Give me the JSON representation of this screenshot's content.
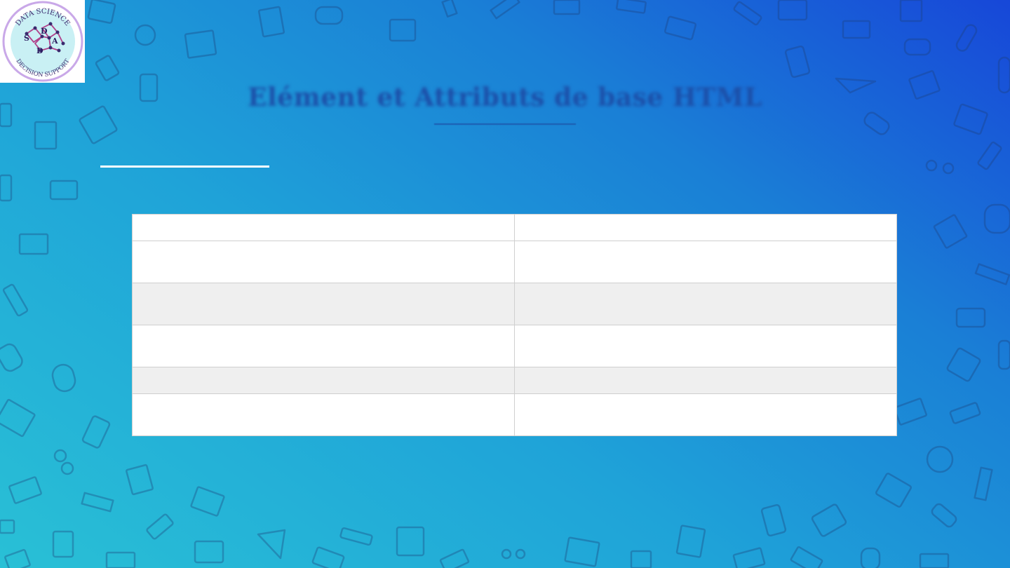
{
  "logo": {
    "top_text": "DATA SCIENCE",
    "bottom_text": "DECISION SUPPORT",
    "letters": [
      "S",
      "D",
      "A",
      "D"
    ]
  },
  "slide": {
    "title": "Elément et Attributs de base HTML"
  },
  "table": {
    "rows": [
      [
        "",
        ""
      ],
      [
        "",
        ""
      ],
      [
        "",
        ""
      ],
      [
        "",
        ""
      ],
      [
        "",
        ""
      ],
      [
        "",
        ""
      ]
    ]
  },
  "colors": {
    "bg_start": "#29c0d6",
    "bg_end": "#1747d8",
    "title": "#1c4fa8",
    "table_alt_row": "#efefef"
  }
}
